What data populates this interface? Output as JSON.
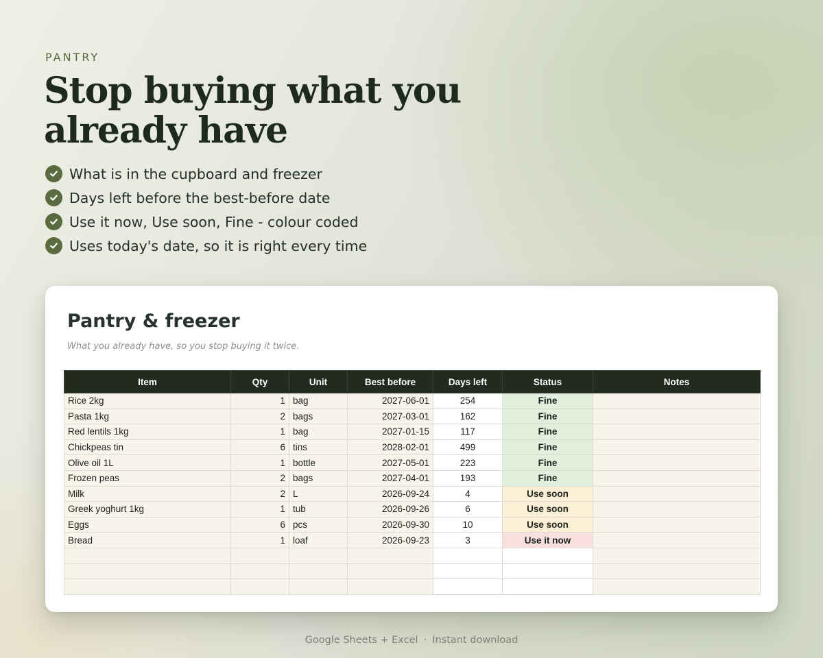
{
  "eyebrow": "PANTRY",
  "headline": "Stop buying what you already have",
  "bullets": [
    "What is in the cupboard and freezer",
    "Days left before the best-before date",
    "Use it now, Use soon, Fine - colour coded",
    "Uses today's date, so it is right every time"
  ],
  "colors": {
    "accent": "#5a6c3f",
    "header_bg": "#232a1f",
    "fine": "#e1efdd",
    "use_soon": "#fbefd6",
    "use_it_now": "#f8e0e0"
  },
  "card": {
    "title": "Pantry & freezer",
    "subtitle": "What you already have, so you stop buying it twice."
  },
  "table": {
    "columns": [
      "Item",
      "Qty",
      "Unit",
      "Best before",
      "Days left",
      "Status",
      "Notes"
    ],
    "rows": [
      [
        "Rice 2kg",
        "1",
        "bag",
        "2027-06-01",
        "254",
        "Fine",
        ""
      ],
      [
        "Pasta 1kg",
        "2",
        "bags",
        "2027-03-01",
        "162",
        "Fine",
        ""
      ],
      [
        "Red lentils 1kg",
        "1",
        "bag",
        "2027-01-15",
        "117",
        "Fine",
        ""
      ],
      [
        "Chickpeas tin",
        "6",
        "tins",
        "2028-02-01",
        "499",
        "Fine",
        ""
      ],
      [
        "Olive oil 1L",
        "1",
        "bottle",
        "2027-05-01",
        "223",
        "Fine",
        ""
      ],
      [
        "Frozen peas",
        "2",
        "bags",
        "2027-04-01",
        "193",
        "Fine",
        ""
      ],
      [
        "Milk",
        "2",
        "L",
        "2026-09-24",
        "4",
        "Use soon",
        ""
      ],
      [
        "Greek yoghurt 1kg",
        "1",
        "tub",
        "2026-09-26",
        "6",
        "Use soon",
        ""
      ],
      [
        "Eggs",
        "6",
        "pcs",
        "2026-09-30",
        "10",
        "Use soon",
        ""
      ],
      [
        "Bread",
        "1",
        "loaf",
        "2026-09-23",
        "3",
        "Use it now",
        ""
      ],
      [
        "",
        "",
        "",
        "",
        "",
        "",
        ""
      ],
      [
        "",
        "",
        "",
        "",
        "",
        "",
        ""
      ],
      [
        "",
        "",
        "",
        "",
        "",
        "",
        ""
      ]
    ]
  },
  "footer": {
    "left": "Google Sheets + Excel",
    "separator": "·",
    "right": "Instant download"
  }
}
